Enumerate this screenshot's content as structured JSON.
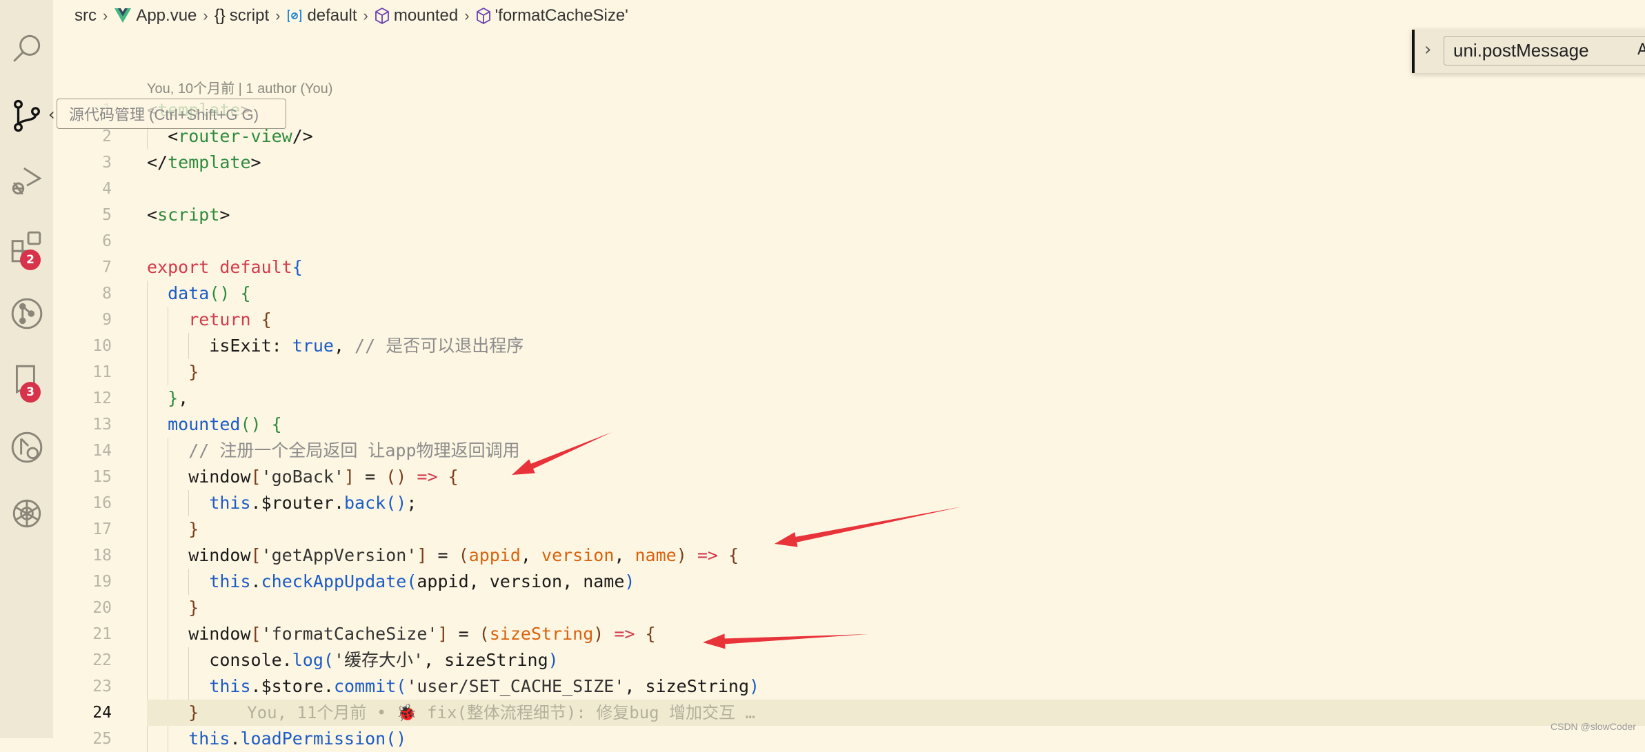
{
  "breadcrumb": [
    {
      "label": "src",
      "icon": "none"
    },
    {
      "label": "App.vue",
      "icon": "vue-icon"
    },
    {
      "label": "script",
      "icon": "braces-icon"
    },
    {
      "label": "default",
      "icon": "variable-icon"
    },
    {
      "label": "mounted",
      "icon": "method-cube-icon"
    },
    {
      "label": "'formatCacheSize'",
      "icon": "method-cube-icon"
    }
  ],
  "activity_bar": {
    "items": [
      {
        "name": "search",
        "icon": "search-icon"
      },
      {
        "name": "source-control",
        "icon": "source-control-icon"
      },
      {
        "name": "run-debug",
        "icon": "run-debug-icon"
      },
      {
        "name": "extensions",
        "icon": "extensions-icon",
        "badge": "2"
      },
      {
        "name": "git-graph",
        "icon": "git-graph-icon"
      },
      {
        "name": "bookmarks",
        "icon": "bookmark-icon",
        "badge": "3"
      },
      {
        "name": "git-lens",
        "icon": "git-lens-icon"
      },
      {
        "name": "chatgpt",
        "icon": "openai-icon"
      }
    ],
    "badge_color": "#d7334a"
  },
  "tooltip": "源代码管理 (Ctrl+Shift+G G)",
  "find_widget": {
    "value": "uni.postMessage",
    "option_label": "A"
  },
  "codelens": "You, 10个月前 | 1 author (You)",
  "current_line": 24,
  "blame": "You, 11个月前 • 🐞 fix(整体流程细节): 修复bug 增加交互 …",
  "code_lines": [
    [
      [
        "<",
        "t-pl"
      ],
      [
        "template",
        "t-tag"
      ],
      [
        ">",
        "t-pl"
      ]
    ],
    [
      [
        "  <",
        "t-pl"
      ],
      [
        "router-view",
        "t-tag"
      ],
      [
        "/>",
        "t-pl"
      ]
    ],
    [
      [
        "</",
        "t-pl"
      ],
      [
        "template",
        "t-tag"
      ],
      [
        ">",
        "t-pl"
      ]
    ],
    [],
    [
      [
        "<",
        "t-pl"
      ],
      [
        "script",
        "t-tag"
      ],
      [
        ">",
        "t-pl"
      ]
    ],
    [],
    [
      [
        "export default",
        "t-kw"
      ],
      [
        "{",
        "t-pb"
      ]
    ],
    [
      [
        "  ",
        "t-pl"
      ],
      [
        "data",
        "t-fn"
      ],
      [
        "()",
        "t-pg"
      ],
      [
        " ",
        "t-pl"
      ],
      [
        "{",
        "t-pg"
      ]
    ],
    [
      [
        "    ",
        "t-pl"
      ],
      [
        "return",
        "t-kw"
      ],
      [
        " {",
        "t-br"
      ]
    ],
    [
      [
        "      isExit: ",
        "t-pl"
      ],
      [
        "true",
        "t-fn"
      ],
      [
        ", ",
        "t-pl"
      ],
      [
        "// 是否可以退出程序",
        "t-cm"
      ]
    ],
    [
      [
        "    ",
        "t-pl"
      ],
      [
        "}",
        "t-br"
      ]
    ],
    [
      [
        "  ",
        "t-pl"
      ],
      [
        "}",
        "t-pg"
      ],
      [
        ",",
        "t-pl"
      ]
    ],
    [
      [
        "  ",
        "t-pl"
      ],
      [
        "mounted",
        "t-fn"
      ],
      [
        "()",
        "t-pg"
      ],
      [
        " ",
        "t-pl"
      ],
      [
        "{",
        "t-pg"
      ]
    ],
    [
      [
        "    ",
        "t-pl"
      ],
      [
        "// 注册一个全局返回 让app物理返回调用",
        "t-cm"
      ]
    ],
    [
      [
        "    window",
        "t-pl"
      ],
      [
        "[",
        "t-br"
      ],
      [
        "'goBack'",
        "t-str"
      ],
      [
        "]",
        "t-br"
      ],
      [
        " = ",
        "t-pl"
      ],
      [
        "()",
        "t-br"
      ],
      [
        " ",
        "t-pl"
      ],
      [
        "=>",
        "t-arrow"
      ],
      [
        " ",
        "t-pl"
      ],
      [
        "{",
        "t-br"
      ]
    ],
    [
      [
        "      ",
        "t-pl"
      ],
      [
        "this",
        "t-fn"
      ],
      [
        ".$router.",
        "t-pl"
      ],
      [
        "back",
        "t-fn"
      ],
      [
        "()",
        "t-pb"
      ],
      [
        ";",
        "t-pl"
      ]
    ],
    [
      [
        "    ",
        "t-pl"
      ],
      [
        "}",
        "t-br"
      ]
    ],
    [
      [
        "    window",
        "t-pl"
      ],
      [
        "[",
        "t-br"
      ],
      [
        "'getAppVersion'",
        "t-str"
      ],
      [
        "]",
        "t-br"
      ],
      [
        " = ",
        "t-pl"
      ],
      [
        "(",
        "t-br"
      ],
      [
        "appid",
        "t-par"
      ],
      [
        ", ",
        "t-pl"
      ],
      [
        "version",
        "t-par"
      ],
      [
        ", ",
        "t-pl"
      ],
      [
        "name",
        "t-par"
      ],
      [
        ")",
        "t-br"
      ],
      [
        " ",
        "t-pl"
      ],
      [
        "=>",
        "t-arrow"
      ],
      [
        " ",
        "t-pl"
      ],
      [
        "{",
        "t-br"
      ]
    ],
    [
      [
        "      ",
        "t-pl"
      ],
      [
        "this",
        "t-fn"
      ],
      [
        ".",
        "t-pl"
      ],
      [
        "checkAppUpdate",
        "t-fn"
      ],
      [
        "(",
        "t-pb"
      ],
      [
        "appid, version, name",
        "t-pl"
      ],
      [
        ")",
        "t-pb"
      ]
    ],
    [
      [
        "    ",
        "t-pl"
      ],
      [
        "}",
        "t-br"
      ]
    ],
    [
      [
        "    window",
        "t-pl"
      ],
      [
        "[",
        "t-br"
      ],
      [
        "'formatCacheSize'",
        "t-str"
      ],
      [
        "]",
        "t-br"
      ],
      [
        " = ",
        "t-pl"
      ],
      [
        "(",
        "t-br"
      ],
      [
        "sizeString",
        "t-par"
      ],
      [
        ")",
        "t-br"
      ],
      [
        " ",
        "t-pl"
      ],
      [
        "=>",
        "t-arrow"
      ],
      [
        " ",
        "t-pl"
      ],
      [
        "{",
        "t-br"
      ]
    ],
    [
      [
        "      console.",
        "t-pl"
      ],
      [
        "log",
        "t-fn"
      ],
      [
        "(",
        "t-pb"
      ],
      [
        "'缓存大小'",
        "t-str"
      ],
      [
        ", sizeString",
        "t-pl"
      ],
      [
        ")",
        "t-pb"
      ]
    ],
    [
      [
        "      ",
        "t-pl"
      ],
      [
        "this",
        "t-fn"
      ],
      [
        ".$store.",
        "t-pl"
      ],
      [
        "commit",
        "t-fn"
      ],
      [
        "(",
        "t-pb"
      ],
      [
        "'user/SET_CACHE_SIZE'",
        "t-str"
      ],
      [
        ", sizeString",
        "t-pl"
      ],
      [
        ")",
        "t-pb"
      ]
    ],
    [
      [
        "    ",
        "t-pl"
      ],
      [
        "}",
        "t-br"
      ]
    ],
    [
      [
        "    ",
        "t-pl"
      ],
      [
        "this",
        "t-fn"
      ],
      [
        ".",
        "t-pl"
      ],
      [
        "loadPermission",
        "t-fn"
      ],
      [
        "()",
        "t-pb"
      ]
    ]
  ],
  "annotation_color": "#e8333a",
  "watermark": "CSDN @slowCoder"
}
